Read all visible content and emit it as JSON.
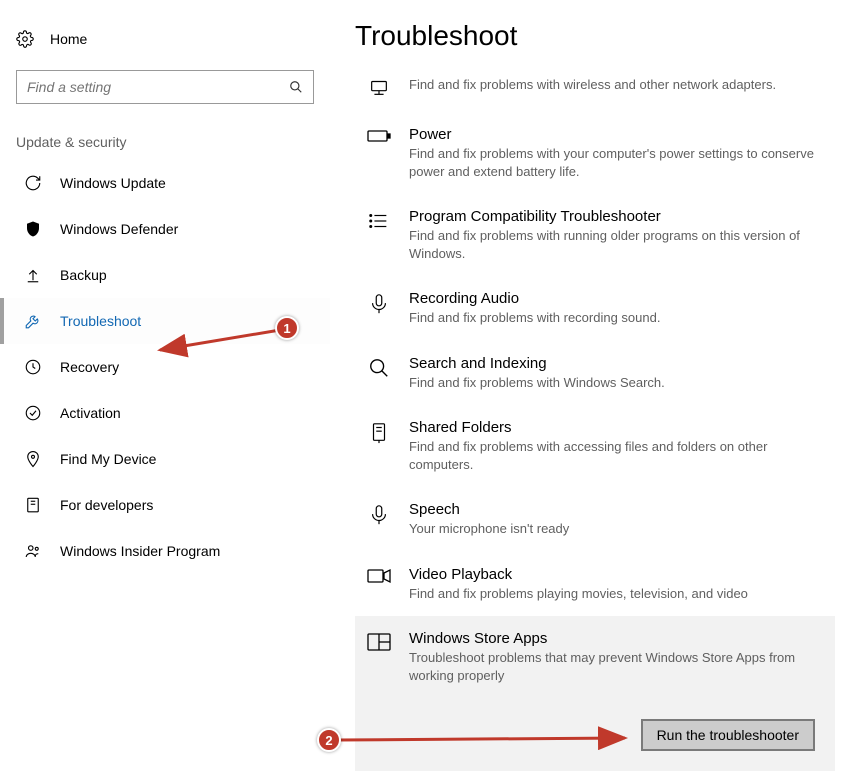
{
  "sidebar": {
    "home": "Home",
    "search_placeholder": "Find a setting",
    "section": "Update & security",
    "items": [
      {
        "label": "Windows Update"
      },
      {
        "label": "Windows Defender"
      },
      {
        "label": "Backup"
      },
      {
        "label": "Troubleshoot",
        "selected": true
      },
      {
        "label": "Recovery"
      },
      {
        "label": "Activation"
      },
      {
        "label": "Find My Device"
      },
      {
        "label": "For developers"
      },
      {
        "label": "Windows Insider Program"
      }
    ]
  },
  "main": {
    "title": "Troubleshoot",
    "items": [
      {
        "title": "Network Adapter",
        "show_title": false,
        "desc": "Find and fix problems with wireless and other network adapters."
      },
      {
        "title": "Power",
        "desc": "Find and fix problems with your computer's power settings to conserve power and extend battery life."
      },
      {
        "title": "Program Compatibility Troubleshooter",
        "desc": "Find and fix problems with running older programs on this version of Windows."
      },
      {
        "title": "Recording Audio",
        "desc": "Find and fix problems with recording sound."
      },
      {
        "title": "Search and Indexing",
        "desc": "Find and fix problems with Windows Search."
      },
      {
        "title": "Shared Folders",
        "desc": "Find and fix problems with accessing files and folders on other computers."
      },
      {
        "title": "Speech",
        "desc": "Your microphone isn't ready"
      },
      {
        "title": "Video Playback",
        "desc": "Find and fix problems playing movies, television, and video"
      },
      {
        "title": "Windows Store Apps",
        "desc": "Troubleshoot problems that may prevent Windows Store Apps from working properly",
        "selected": true
      }
    ],
    "run_button": "Run the troubleshooter"
  },
  "annotations": {
    "a1": "1",
    "a2": "2"
  }
}
